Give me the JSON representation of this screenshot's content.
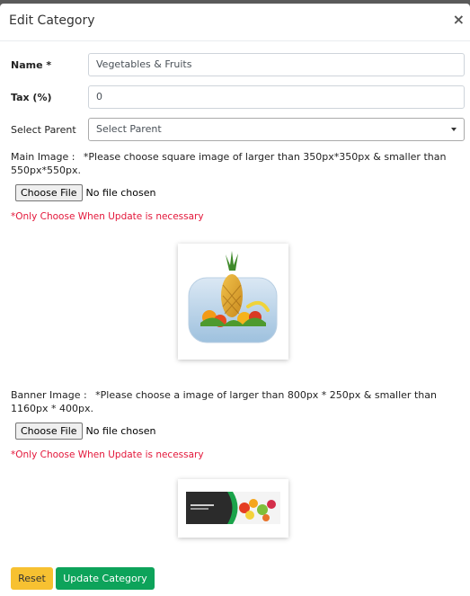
{
  "modal": {
    "title": "Edit Category",
    "close_glyph": "×"
  },
  "form": {
    "name_label": "Name *",
    "name_value": "Vegetables & Fruits",
    "tax_label": "Tax (%)",
    "tax_value": "0",
    "parent_label": "Select Parent",
    "parent_value": "Select Parent",
    "main_image_label": "Main Image :",
    "main_image_note": "*Please choose square image of larger than 350px*350px & smaller than 550px*550px.",
    "banner_image_label": "Banner Image :",
    "banner_image_note": "*Please choose a image of larger than 800px * 250px & smaller than 1160px * 400px.",
    "choose_file_label": "Choose File",
    "no_file_text": "No file chosen",
    "update_warning": "*Only Choose When Update is necessary"
  },
  "buttons": {
    "reset_label": "Reset",
    "update_label": "Update Category"
  },
  "colors": {
    "warning_text": "#e3173a",
    "reset_bg": "#f7c131",
    "update_bg": "#0da35a"
  }
}
